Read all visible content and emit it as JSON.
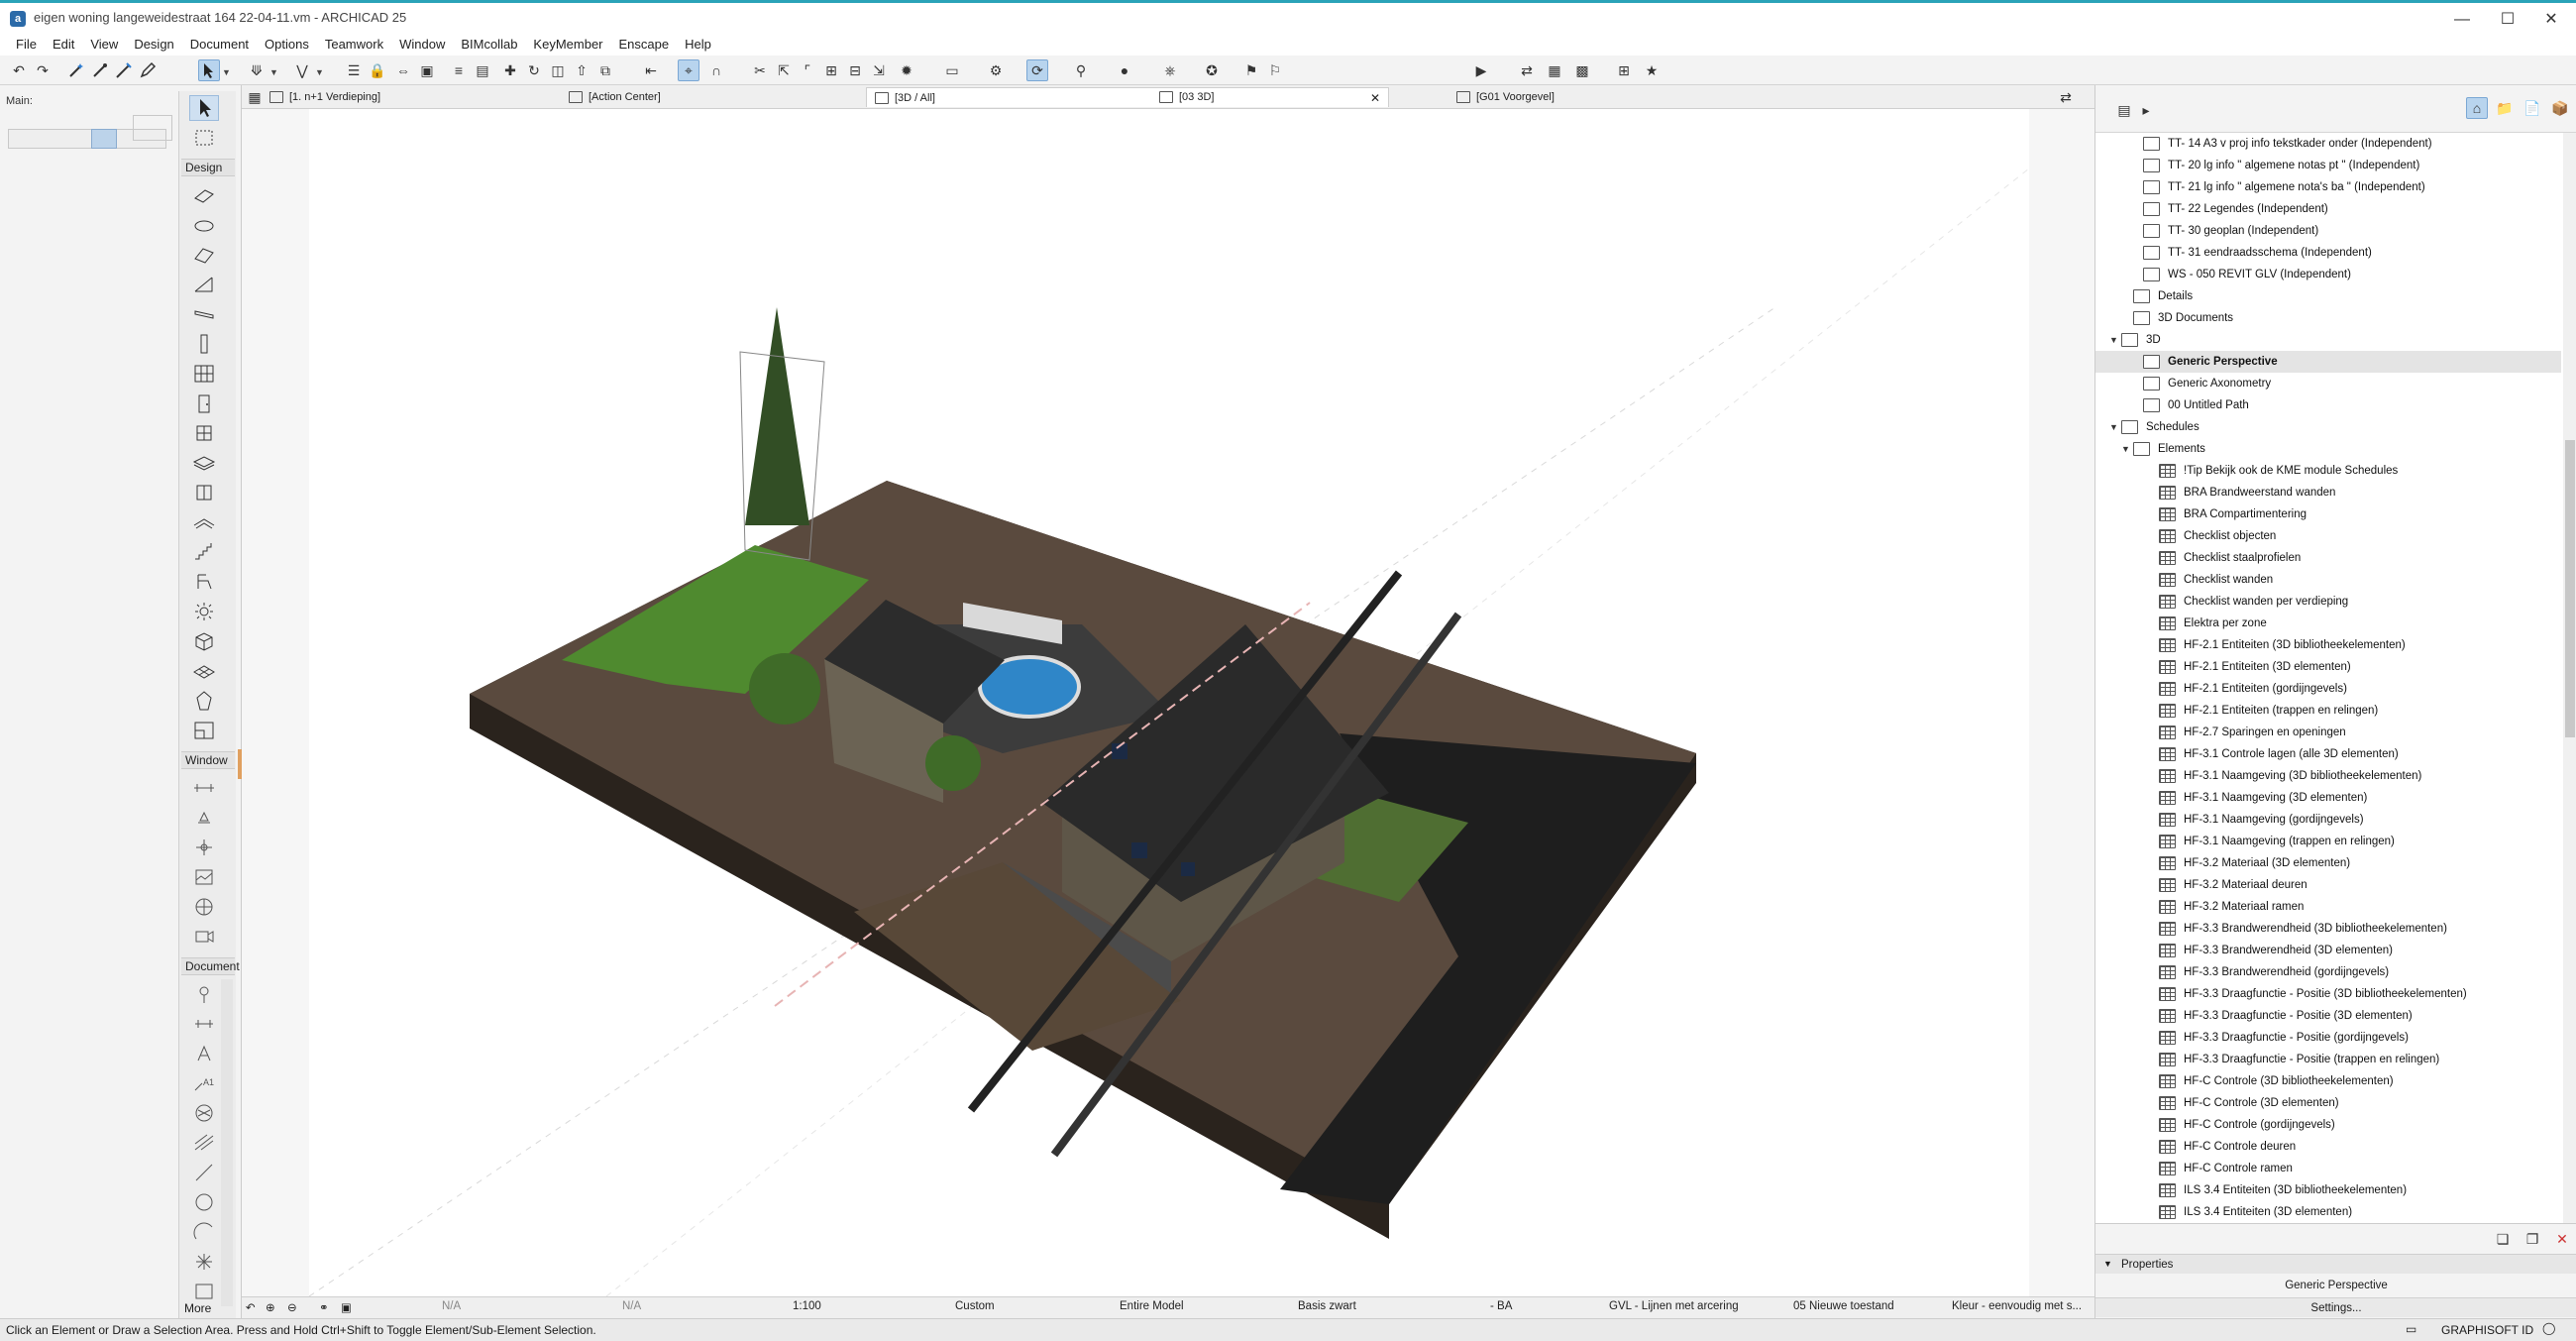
{
  "app": {
    "window_title": "eigen woning langeweidestraat 164 22-04-11.vm - ARCHICAD 25",
    "menu": [
      "File",
      "Edit",
      "View",
      "Design",
      "Document",
      "Options",
      "Teamwork",
      "Window",
      "BIMcollab",
      "KeyMember",
      "Enscape",
      "Help"
    ]
  },
  "left": {
    "main_label": "Main:",
    "sections": {
      "design": "Design",
      "window": "Window",
      "document": "Document",
      "more": "More"
    }
  },
  "tabs": [
    "[1. n+1 Verdieping]",
    "[Action Center]",
    "[3D / All]",
    "[03 3D]",
    "[G01 Voorgevel]"
  ],
  "navigator": {
    "items": [
      {
        "label": "TT- 14 A3 v proj info  tekstkader onder  (Independent)",
        "level": 2,
        "icon": "layout"
      },
      {
        "label": "TT- 20 lg info \" algemene notas pt \" (Independent)",
        "level": 2,
        "icon": "layout"
      },
      {
        "label": "TT- 21 lg info \" algemene nota's ba \" (Independent)",
        "level": 2,
        "icon": "layout"
      },
      {
        "label": "TT- 22 Legendes (Independent)",
        "level": 2,
        "icon": "layout"
      },
      {
        "label": "TT- 30 geoplan  (Independent)",
        "level": 2,
        "icon": "layout"
      },
      {
        "label": "TT- 31 eendraadsschema (Independent)",
        "level": 2,
        "icon": "layout"
      },
      {
        "label": "WS - 050 REVIT GLV (Independent)",
        "level": 2,
        "icon": "layout"
      },
      {
        "label": "Details",
        "level": 1,
        "icon": "detail"
      },
      {
        "label": "3D Documents",
        "level": 1,
        "icon": "doc3d"
      },
      {
        "label": "3D",
        "level": 0,
        "icon": "folder3d",
        "expanded": true
      },
      {
        "label": "Generic Perspective",
        "level": 2,
        "icon": "view",
        "selected": true
      },
      {
        "label": "Generic Axonometry",
        "level": 2,
        "icon": "view"
      },
      {
        "label": "00 Untitled Path",
        "level": 2,
        "icon": "path"
      },
      {
        "label": "Schedules",
        "level": 0,
        "icon": "schedule",
        "expanded": true
      },
      {
        "label": "Elements",
        "level": 1,
        "icon": "schedule",
        "expanded": true
      },
      {
        "label": "!Tip Bekijk ook de KME module Schedules",
        "level": 3,
        "icon": "grid"
      },
      {
        "label": "BRA Brandweerstand wanden",
        "level": 3,
        "icon": "grid"
      },
      {
        "label": "BRA Compartimentering",
        "level": 3,
        "icon": "grid"
      },
      {
        "label": "Checklist objecten",
        "level": 3,
        "icon": "grid"
      },
      {
        "label": "Checklist staalprofielen",
        "level": 3,
        "icon": "grid"
      },
      {
        "label": "Checklist wanden",
        "level": 3,
        "icon": "grid"
      },
      {
        "label": "Checklist wanden per verdieping",
        "level": 3,
        "icon": "grid"
      },
      {
        "label": "Elektra per zone",
        "level": 3,
        "icon": "grid"
      },
      {
        "label": "HF-2.1 Entiteiten (3D bibliotheekelementen)",
        "level": 3,
        "icon": "grid"
      },
      {
        "label": "HF-2.1 Entiteiten (3D elementen)",
        "level": 3,
        "icon": "grid"
      },
      {
        "label": "HF-2.1 Entiteiten (gordijngevels)",
        "level": 3,
        "icon": "grid"
      },
      {
        "label": "HF-2.1 Entiteiten (trappen en relingen)",
        "level": 3,
        "icon": "grid"
      },
      {
        "label": "HF-2.7 Sparingen en openingen",
        "level": 3,
        "icon": "grid"
      },
      {
        "label": "HF-3.1 Controle lagen (alle 3D elementen)",
        "level": 3,
        "icon": "grid"
      },
      {
        "label": "HF-3.1 Naamgeving (3D bibliotheekelementen)",
        "level": 3,
        "icon": "grid"
      },
      {
        "label": "HF-3.1 Naamgeving (3D elementen)",
        "level": 3,
        "icon": "grid"
      },
      {
        "label": "HF-3.1 Naamgeving (gordijngevels)",
        "level": 3,
        "icon": "grid"
      },
      {
        "label": "HF-3.1 Naamgeving (trappen en relingen)",
        "level": 3,
        "icon": "grid"
      },
      {
        "label": "HF-3.2 Materiaal (3D elementen)",
        "level": 3,
        "icon": "grid"
      },
      {
        "label": "HF-3.2 Materiaal deuren",
        "level": 3,
        "icon": "grid"
      },
      {
        "label": "HF-3.2 Materiaal ramen",
        "level": 3,
        "icon": "grid"
      },
      {
        "label": "HF-3.3 Brandwerendheid (3D bibliotheekelementen)",
        "level": 3,
        "icon": "grid"
      },
      {
        "label": "HF-3.3 Brandwerendheid (3D elementen)",
        "level": 3,
        "icon": "grid"
      },
      {
        "label": "HF-3.3 Brandwerendheid (gordijngevels)",
        "level": 3,
        "icon": "grid"
      },
      {
        "label": "HF-3.3 Draagfunctie - Positie (3D bibliotheekelementen)",
        "level": 3,
        "icon": "grid"
      },
      {
        "label": "HF-3.3 Draagfunctie - Positie (3D elementen)",
        "level": 3,
        "icon": "grid"
      },
      {
        "label": "HF-3.3 Draagfunctie - Positie (gordijngevels)",
        "level": 3,
        "icon": "grid"
      },
      {
        "label": "HF-3.3 Draagfunctie - Positie (trappen en relingen)",
        "level": 3,
        "icon": "grid"
      },
      {
        "label": "HF-C Controle (3D bibliotheekelementen)",
        "level": 3,
        "icon": "grid"
      },
      {
        "label": "HF-C Controle (3D elementen)",
        "level": 3,
        "icon": "grid"
      },
      {
        "label": "HF-C Controle (gordijngevels)",
        "level": 3,
        "icon": "grid"
      },
      {
        "label": "HF-C Controle deuren",
        "level": 3,
        "icon": "grid"
      },
      {
        "label": "HF-C Controle ramen",
        "level": 3,
        "icon": "grid"
      },
      {
        "label": "ILS 3.4 Entiteiten (3D bibliotheekelementen)",
        "level": 3,
        "icon": "grid"
      },
      {
        "label": "ILS 3.4 Entiteiten (3D elementen)",
        "level": 3,
        "icon": "grid"
      }
    ]
  },
  "properties": {
    "header": "Properties",
    "view_name": "Generic Perspective",
    "settings_button": "Settings..."
  },
  "optionbar": {
    "na1": "N/A",
    "na2": "N/A",
    "scale": "1:100",
    "layer_combo": "Custom",
    "model_view": "Entire Model",
    "pen_set": "Basis zwart",
    "dim": "- BA",
    "graphic_override": "GVL - Lijnen met arcering",
    "renovation": "05 Nieuwe toestand",
    "color": "Kleur - eenvoudig met s..."
  },
  "status": {
    "message": "Click an Element or Draw a Selection Area. Press and Hold Ctrl+Shift to Toggle Element/Sub-Element Selection.",
    "brand": "GRAPHISOFT ID"
  },
  "colors": {
    "accent": "#2aa3b8",
    "ground": "#5a4a3e",
    "lawn": "#4f8a2f",
    "road": "#1e1e1e",
    "pool": "#2f86c8"
  }
}
